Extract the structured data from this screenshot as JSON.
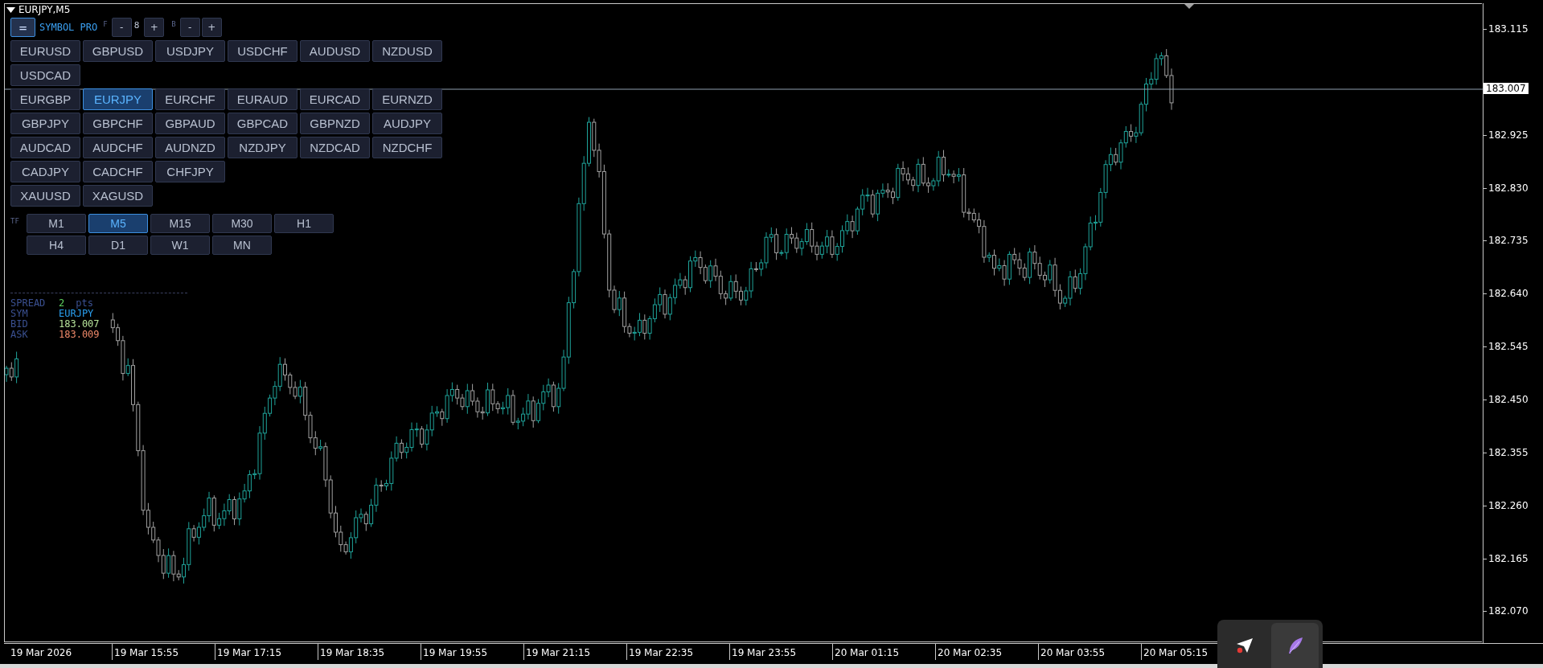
{
  "chart": {
    "title": "EURJPY,M5",
    "current_price": "183.007"
  },
  "panel": {
    "menu_button": "=",
    "brand": "SYMBOL PRO",
    "font_label": "F",
    "font_minus": "-",
    "font_size": "8",
    "font_plus": "+",
    "bg_label": "B",
    "bg_minus": "-",
    "bg_plus": "+",
    "symbol_rows": [
      [
        {
          "label": "EURUSD",
          "selected": false
        },
        {
          "label": "GBPUSD",
          "selected": false
        },
        {
          "label": "USDJPY",
          "selected": false
        },
        {
          "label": "USDCHF",
          "selected": false
        },
        {
          "label": "AUDUSD",
          "selected": false
        },
        {
          "label": "NZDUSD",
          "selected": false
        }
      ],
      [
        {
          "label": "USDCAD",
          "selected": false
        }
      ],
      [
        {
          "label": "EURGBP",
          "selected": false
        },
        {
          "label": "EURJPY",
          "selected": true
        },
        {
          "label": "EURCHF",
          "selected": false
        },
        {
          "label": "EURAUD",
          "selected": false
        },
        {
          "label": "EURCAD",
          "selected": false
        },
        {
          "label": "EURNZD",
          "selected": false
        }
      ],
      [
        {
          "label": "GBPJPY",
          "selected": false
        },
        {
          "label": "GBPCHF",
          "selected": false
        },
        {
          "label": "GBPAUD",
          "selected": false
        },
        {
          "label": "GBPCAD",
          "selected": false
        },
        {
          "label": "GBPNZD",
          "selected": false
        },
        {
          "label": "AUDJPY",
          "selected": false
        }
      ],
      [
        {
          "label": "AUDCAD",
          "selected": false
        },
        {
          "label": "AUDCHF",
          "selected": false
        },
        {
          "label": "AUDNZD",
          "selected": false
        },
        {
          "label": "NZDJPY",
          "selected": false
        },
        {
          "label": "NZDCAD",
          "selected": false
        },
        {
          "label": "NZDCHF",
          "selected": false
        }
      ],
      [
        {
          "label": "CADJPY",
          "selected": false
        },
        {
          "label": "CADCHF",
          "selected": false
        },
        {
          "label": "CHFJPY",
          "selected": false
        }
      ],
      [
        {
          "label": "XAUUSD",
          "selected": false
        },
        {
          "label": "XAGUSD",
          "selected": false
        }
      ]
    ],
    "tf_label": "TF",
    "timeframe_rows": [
      [
        {
          "label": "M1",
          "selected": false
        },
        {
          "label": "M5",
          "selected": true
        },
        {
          "label": "M15",
          "selected": false
        },
        {
          "label": "M30",
          "selected": false
        },
        {
          "label": "H1",
          "selected": false
        }
      ],
      [
        {
          "label": "H4",
          "selected": false
        },
        {
          "label": "D1",
          "selected": false
        },
        {
          "label": "W1",
          "selected": false
        },
        {
          "label": "MN",
          "selected": false
        }
      ]
    ]
  },
  "info": {
    "spread_label": "SPREAD",
    "spread": "2",
    "spread_unit": "pts",
    "symbol_label": "SYM",
    "symbol": "EURJPY",
    "bid_label": "BID",
    "bid": "183.007",
    "ask_label": "ASK",
    "ask": "183.009"
  },
  "price_axis": [
    "183.115",
    "182.925",
    "182.830",
    "182.735",
    "182.640",
    "182.545",
    "182.450",
    "182.355",
    "182.260",
    "182.165",
    "182.070"
  ],
  "time_axis": [
    "19 Mar 2026",
    "19 Mar 15:55",
    "19 Mar 17:15",
    "19 Mar 18:35",
    "19 Mar 19:55",
    "19 Mar 21:15",
    "19 Mar 22:35",
    "19 Mar 23:55",
    "20 Mar 01:15",
    "20 Mar 02:35",
    "20 Mar 03:55",
    "20 Mar 05:15"
  ],
  "tools": [
    {
      "kind": "send",
      "selected": false
    },
    {
      "kind": "feather",
      "selected": true
    }
  ]
}
